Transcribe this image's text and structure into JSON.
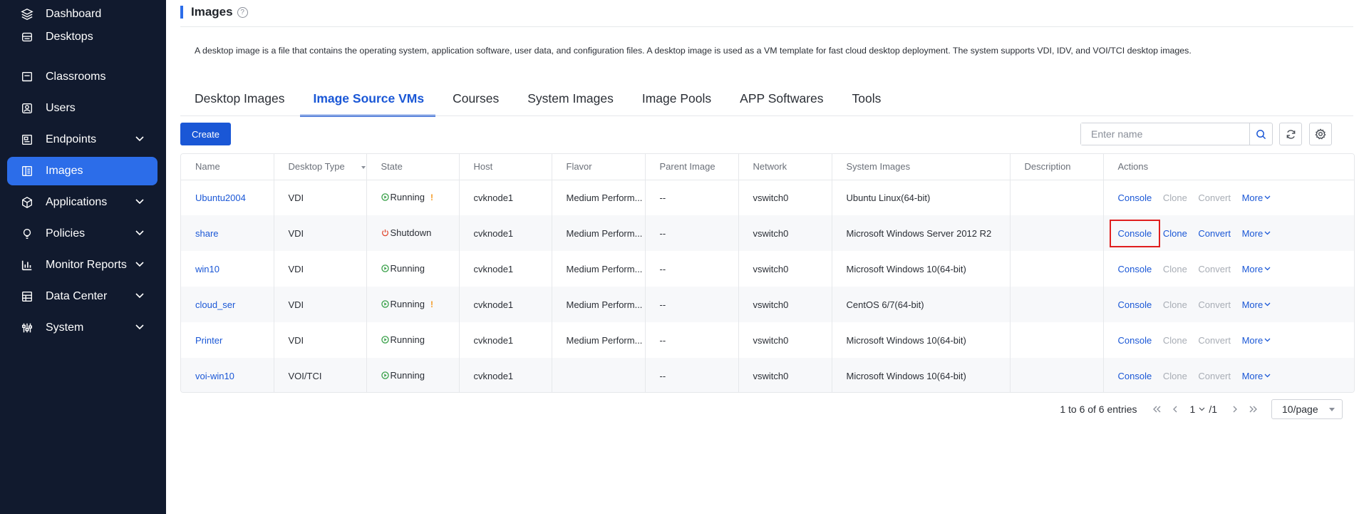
{
  "sidebar": {
    "items": [
      {
        "label": "Dashboard",
        "icon": "layers-icon",
        "expandable": false,
        "active": false
      },
      {
        "label": "Desktops",
        "icon": "desktops-icon",
        "expandable": false,
        "active": false
      },
      {
        "label": "Classrooms",
        "icon": "classroom-icon",
        "expandable": false,
        "active": false
      },
      {
        "label": "Users",
        "icon": "user-icon",
        "expandable": false,
        "active": false
      },
      {
        "label": "Endpoints",
        "icon": "endpoint-icon",
        "expandable": true,
        "active": false
      },
      {
        "label": "Images",
        "icon": "image-icon",
        "expandable": false,
        "active": true
      },
      {
        "label": "Applications",
        "icon": "cube-icon",
        "expandable": true,
        "active": false
      },
      {
        "label": "Policies",
        "icon": "lightbulb-icon",
        "expandable": true,
        "active": false
      },
      {
        "label": "Monitor Reports",
        "icon": "bar-chart-icon",
        "expandable": true,
        "active": false
      },
      {
        "label": "Data Center",
        "icon": "database-icon",
        "expandable": true,
        "active": false
      },
      {
        "label": "System",
        "icon": "sliders-icon",
        "expandable": true,
        "active": false
      }
    ]
  },
  "page": {
    "title": "Images",
    "help": "?",
    "description": "A desktop image is a file that contains the operating system, application software, user data, and configuration files. A desktop image is used as a VM template for fast cloud desktop deployment. The system supports VDI, IDV, and VOI/TCI desktop images."
  },
  "tabs": [
    {
      "label": "Desktop Images",
      "active": false
    },
    {
      "label": "Image Source VMs",
      "active": true
    },
    {
      "label": "Courses",
      "active": false
    },
    {
      "label": "System Images",
      "active": false
    },
    {
      "label": "Image Pools",
      "active": false
    },
    {
      "label": "APP Softwares",
      "active": false
    },
    {
      "label": "Tools",
      "active": false
    }
  ],
  "toolbar": {
    "create_label": "Create",
    "search_placeholder": "Enter name",
    "search_value": ""
  },
  "table": {
    "columns": [
      "Name",
      "Desktop Type",
      "State",
      "Host",
      "Flavor",
      "Parent Image",
      "Network",
      "System Images",
      "Description",
      "Actions"
    ],
    "rows": [
      {
        "name": "Ubuntu2004",
        "type": "VDI",
        "state": "Running",
        "state_kind": "running",
        "warning": "!",
        "host": "cvknode1",
        "flavor": "Medium Perform...",
        "parent": "--",
        "network": "vswitch0",
        "system_image": "Ubuntu Linux(64-bit)",
        "description": "",
        "actions": {
          "console": "Console",
          "clone": "Clone",
          "convert": "Convert",
          "more": "More",
          "clone_enabled": false,
          "convert_enabled": false
        }
      },
      {
        "name": "share",
        "type": "VDI",
        "state": "Shutdown",
        "state_kind": "shutdown",
        "warning": "",
        "host": "cvknode1",
        "flavor": "Medium Perform...",
        "parent": "--",
        "network": "vswitch0",
        "system_image": "Microsoft Windows Server 2012 R2",
        "description": "",
        "actions": {
          "console": "Console",
          "clone": "Clone",
          "convert": "Convert",
          "more": "More",
          "clone_enabled": true,
          "convert_enabled": true
        }
      },
      {
        "name": "win10",
        "type": "VDI",
        "state": "Running",
        "state_kind": "running",
        "warning": "",
        "host": "cvknode1",
        "flavor": "Medium Perform...",
        "parent": "--",
        "network": "vswitch0",
        "system_image": "Microsoft Windows 10(64-bit)",
        "description": "",
        "actions": {
          "console": "Console",
          "clone": "Clone",
          "convert": "Convert",
          "more": "More",
          "clone_enabled": false,
          "convert_enabled": false
        }
      },
      {
        "name": "cloud_ser",
        "type": "VDI",
        "state": "Running",
        "state_kind": "running",
        "warning": "!",
        "host": "cvknode1",
        "flavor": "Medium Perform...",
        "parent": "--",
        "network": "vswitch0",
        "system_image": "CentOS 6/7(64-bit)",
        "description": "",
        "actions": {
          "console": "Console",
          "clone": "Clone",
          "convert": "Convert",
          "more": "More",
          "clone_enabled": false,
          "convert_enabled": false
        }
      },
      {
        "name": "Printer",
        "type": "VDI",
        "state": "Running",
        "state_kind": "running",
        "warning": "",
        "host": "cvknode1",
        "flavor": "Medium Perform...",
        "parent": "--",
        "network": "vswitch0",
        "system_image": "Microsoft Windows 10(64-bit)",
        "description": "",
        "actions": {
          "console": "Console",
          "clone": "Clone",
          "convert": "Convert",
          "more": "More",
          "clone_enabled": false,
          "convert_enabled": false
        }
      },
      {
        "name": "voi-win10",
        "type": "VOI/TCI",
        "state": "Running",
        "state_kind": "running",
        "warning": "",
        "host": "cvknode1",
        "flavor": "",
        "parent": "--",
        "network": "vswitch0",
        "system_image": "Microsoft Windows 10(64-bit)",
        "description": "",
        "actions": {
          "console": "Console",
          "clone": "Clone",
          "convert": "Convert",
          "more": "More",
          "clone_enabled": false,
          "convert_enabled": false
        }
      }
    ]
  },
  "pagination": {
    "total_text": "1 to 6 of 6 entries",
    "current_page": "1",
    "total_pages": "/1",
    "page_size": "10/page"
  },
  "colors": {
    "sidebar_bg": "#111a2e",
    "accent": "#1a57d6",
    "active_nav": "#2c6de9",
    "running": "#3aa14a",
    "shutdown": "#e0452c",
    "warning": "#f59a23",
    "highlight": "#e01e1e"
  }
}
